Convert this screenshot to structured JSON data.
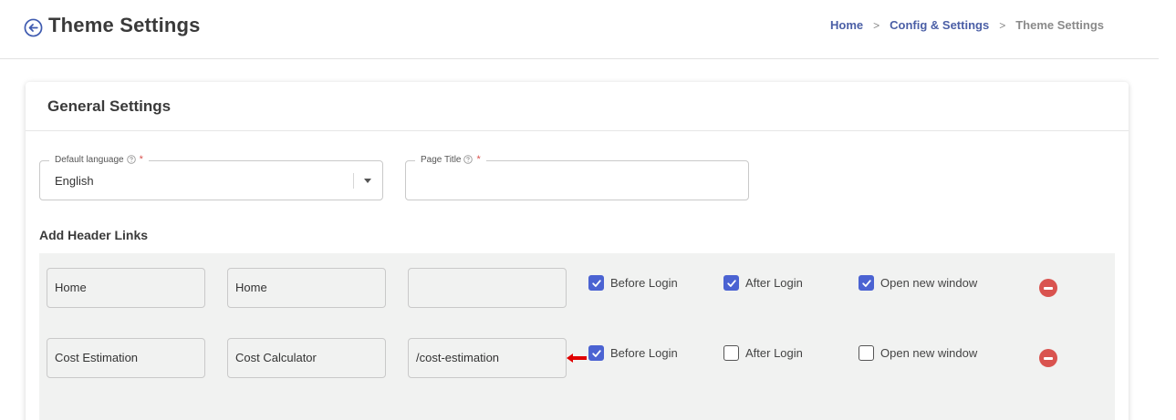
{
  "header": {
    "title": "Theme Settings",
    "back_icon": "arrow-left-circle-icon",
    "breadcrumb": [
      {
        "label": "Home"
      },
      {
        "label": "Config & Settings"
      },
      {
        "label": "Theme Settings"
      }
    ],
    "separator": ">"
  },
  "card": {
    "title": "General Settings",
    "default_language": {
      "label": "Default language",
      "required_mark": "*",
      "value": "English"
    },
    "page_title": {
      "label": "Page Title",
      "required_mark": "*",
      "value": ""
    },
    "header_links_heading": "Add Header Links"
  },
  "header_links": {
    "checkbox_labels": {
      "before_login": "Before Login",
      "after_login": "After Login",
      "open_new_window": "Open new window"
    },
    "rows": [
      {
        "name": "Home",
        "title": "Home",
        "url": "",
        "before_login": true,
        "after_login": true,
        "open_new_window": true
      },
      {
        "name": "Cost Estimation",
        "title": "Cost Calculator",
        "url": "/cost-estimation",
        "before_login": true,
        "after_login": false,
        "open_new_window": false
      }
    ]
  },
  "colors": {
    "accent": "#4b63d2",
    "link": "#4b5fa6",
    "danger": "#d9534f",
    "panel": "#f1f2f1",
    "annotation": "#e00000"
  }
}
